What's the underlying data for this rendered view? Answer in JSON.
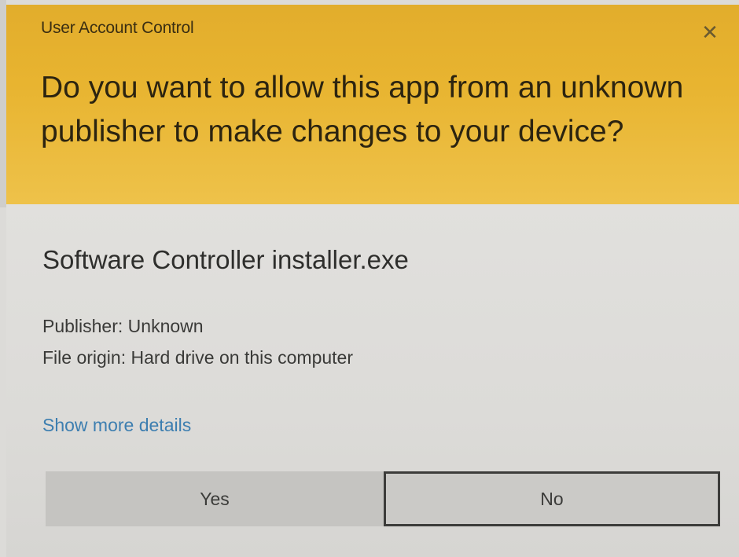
{
  "dialog": {
    "title": "User Account Control",
    "close_glyph": "✕",
    "question": "Do you want to allow this app from an unknown publisher to make changes to your device?",
    "app_name": "Software Controller installer.exe",
    "publisher_line": "Publisher: Unknown",
    "origin_line": "File origin: Hard drive on this computer",
    "more_details_link": "Show more details",
    "yes_label": "Yes",
    "no_label": "No"
  },
  "colors": {
    "header_accent": "#e8b430",
    "link": "#3d7eb0",
    "body_bg": "#dcdbd8"
  },
  "icons": {
    "close": "close-icon"
  }
}
